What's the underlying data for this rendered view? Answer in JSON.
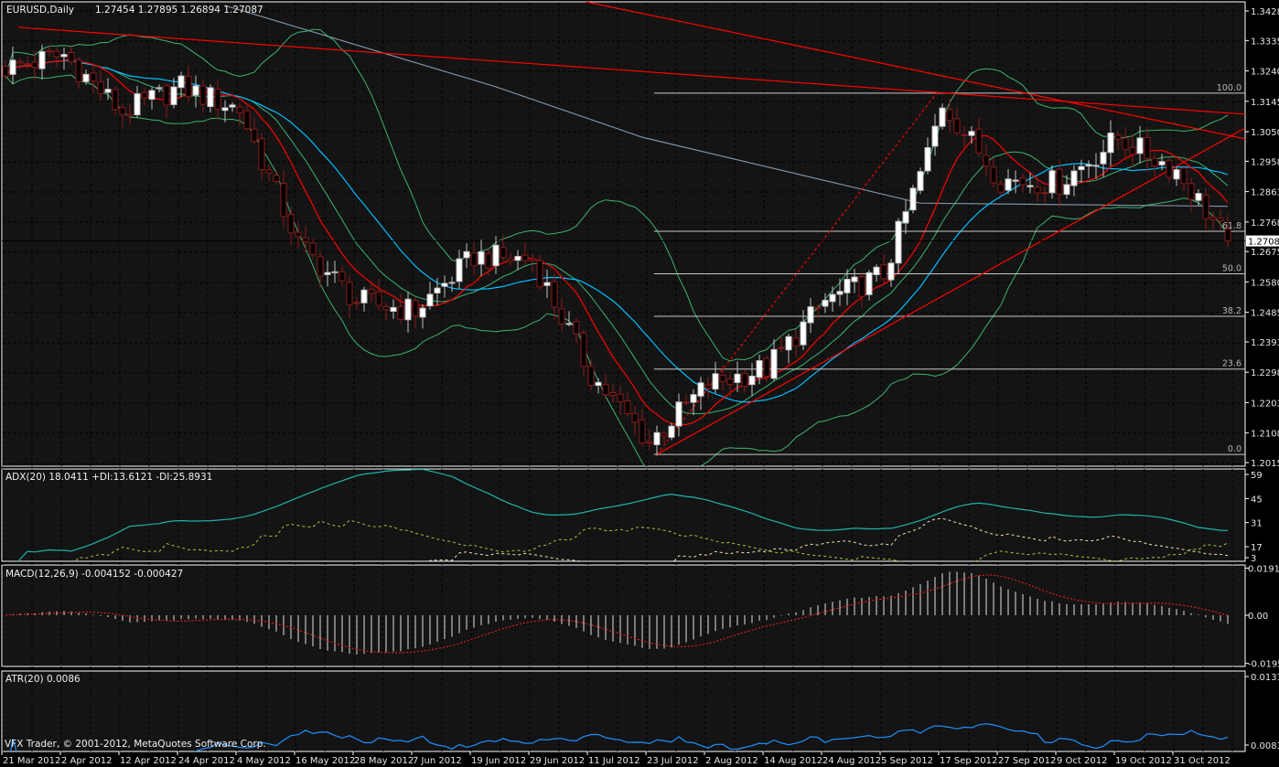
{
  "header": {
    "symbol_timeframe": "EURUSD,Daily",
    "ohlc_text": "1.27454 1.27895 1.26894 1.27087"
  },
  "footer": {
    "copyright": "VFX Trader, © 2001-2012, MetaQuotes Software Corp."
  },
  "colors": {
    "background": "#000000",
    "panel": "#141414",
    "bull_body": "#ffffff",
    "bear_outline": "#8b1a1a",
    "ma_fast": "#ff0000",
    "ma_slow": "#00bfff",
    "bollinger": "#3cb371",
    "ma_long": "#8090a0",
    "adx": "#20b2aa",
    "plus_di": "#f5deb3",
    "minus_di": "#9acd32",
    "macd_signal": "#ff2020",
    "atr": "#1e90ff"
  },
  "chart_data": {
    "type": "candlestick",
    "symbol": "EURUSD",
    "timeframe": "Daily",
    "last_bar": {
      "open": 1.27454,
      "high": 1.27895,
      "low": 1.26894,
      "close": 1.27087
    },
    "current_price_label": "1.27087",
    "current_price": 1.27087,
    "ylim": [
      1.20155,
      1.3428
    ],
    "price_ticks": [
      "1.34280",
      "1.33355",
      "1.32405",
      "1.31455",
      "1.30505",
      "1.29580",
      "1.28630",
      "1.27680",
      "1.26755",
      "1.25805",
      "1.24855",
      "1.23930",
      "1.22980",
      "1.22030",
      "1.21080",
      "1.20155"
    ],
    "bars_count": 168,
    "x_tick_labels": [
      "21 Mar 2012",
      "2 Apr 2012",
      "12 Apr 2012",
      "24 Apr 2012",
      "4 May 2012",
      "16 May 2012",
      "28 May 2012",
      "7 Jun 2012",
      "19 Jun 2012",
      "29 Jun 2012",
      "11 Jul 2012",
      "23 Jul 2012",
      "2 Aug 2012",
      "14 Aug 2012",
      "24 Aug 2012",
      "5 Sep 2012",
      "17 Sep 2012",
      "27 Sep 2012",
      "9 Oct 2012",
      "19 Oct 2012",
      "31 Oct 2012"
    ],
    "close_anchors": {
      "bar": [
        0,
        8,
        16,
        24,
        32,
        40,
        48,
        56,
        64,
        72,
        80,
        88,
        96,
        104,
        112,
        120,
        126,
        128,
        136,
        144,
        152,
        160,
        167
      ],
      "close": [
        1.325,
        1.329,
        1.311,
        1.319,
        1.312,
        1.27,
        1.252,
        1.249,
        1.266,
        1.265,
        1.229,
        1.208,
        1.226,
        1.231,
        1.252,
        1.2605,
        1.298,
        1.314,
        1.29,
        1.289,
        1.303,
        1.293,
        1.27087
      ]
    },
    "long_ma_anchors": {
      "bar": [
        30,
        67,
        87,
        125,
        167
      ],
      "value": [
        1.3445,
        1.3191,
        1.3033,
        1.2827,
        1.2817
      ]
    },
    "fibonacci": {
      "start_bar": 88.6,
      "levels": [
        {
          "label": "100.0",
          "price": 1.3171
        },
        {
          "label": "61.8",
          "price": 1.2739
        },
        {
          "label": "50.0",
          "price": 1.2606
        },
        {
          "label": "38.2",
          "price": 1.2473
        },
        {
          "label": "23.6",
          "price": 1.2308
        },
        {
          "label": "0.0",
          "price": 1.2041
        }
      ]
    },
    "trendlines": [
      {
        "from": [
          1.75,
          1.3377
        ],
        "to": [
          169.4,
          1.3105
        ],
        "style": "solid"
      },
      {
        "from": [
          79.25,
          1.3457
        ],
        "to": [
          169.4,
          1.3028
        ],
        "style": "solid"
      },
      {
        "from": [
          89,
          1.2041
        ],
        "to": [
          169.4,
          1.3062
        ],
        "style": "solid"
      },
      {
        "from": [
          89,
          1.2041
        ],
        "to": [
          127.4,
          1.3176
        ],
        "style": "dashed"
      }
    ],
    "indicators": {
      "adx": {
        "label": "ADX(20) 18.0411 +DI:13.6121 -DI:25.8931",
        "period": 20,
        "ticks": [
          "59",
          "45",
          "31",
          "17",
          "3"
        ],
        "tick_values": [
          59,
          45,
          31,
          17,
          3
        ]
      },
      "macd": {
        "label": "MACD(12,26,9) -0.004152 -0.000427",
        "fast": 12,
        "slow": 26,
        "signal": 9,
        "ticks": [
          "0.01914",
          "0.00",
          "-0.01955"
        ],
        "tick_values": [
          0.01914,
          0,
          -0.01955
        ]
      },
      "atr": {
        "label": "ATR(20) 0.0086",
        "period": 20,
        "ticks": [
          "0.0131",
          "0.0083"
        ],
        "tick_values": [
          0.0131,
          0.0083
        ]
      }
    }
  }
}
